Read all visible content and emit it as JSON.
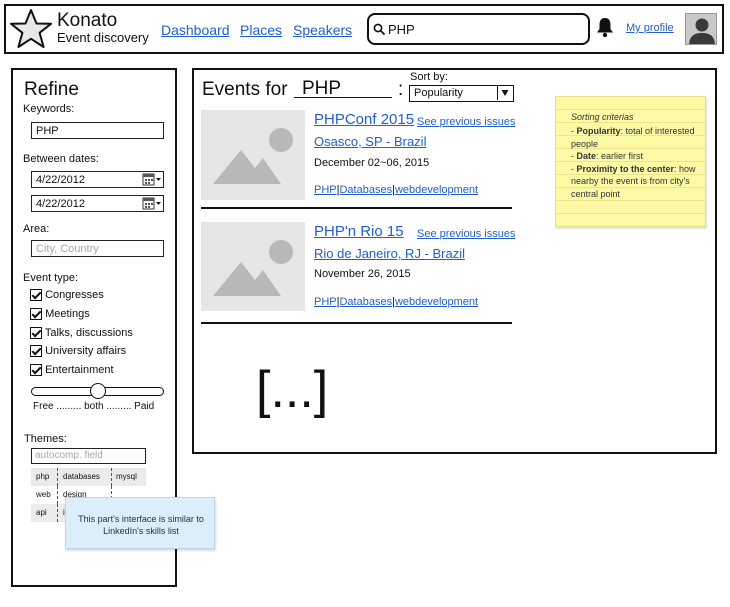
{
  "header": {
    "brand_name": "Konato",
    "brand_tagline": "Event discovery",
    "nav": [
      "Dashboard",
      "Places",
      "Speakers"
    ],
    "search_value": "PHP",
    "profile_link": "My profile"
  },
  "sidebar": {
    "title": "Refine",
    "keywords_label": "Keywords:",
    "keywords_value": "PHP",
    "dates_label": "Between dates:",
    "date_from": "4/22/2012",
    "date_to": "4/22/2012",
    "area_label": "Area:",
    "area_placeholder": "City, Country",
    "event_type_label": "Event type:",
    "event_types": [
      "Congresses",
      "Meetings",
      "Talks, discussions",
      "University affairs",
      "Entertainment"
    ],
    "price_scale": "Free ......... both ......... Paid",
    "price_value": 0.5,
    "themes_label": "Themes:",
    "themes_placeholder": "autocomp. field",
    "themes": [
      [
        "php",
        "databases",
        "mysql"
      ],
      [
        "web",
        "design",
        ""
      ],
      [
        "api",
        "i",
        ""
      ]
    ],
    "themes_note": "This part's interface is similar to LinkedIn's skills list"
  },
  "main": {
    "events_for_label": "Events for",
    "query": "PHP",
    "colon": ":",
    "sort_label": "Sort by:",
    "sort_value": "Popularity",
    "see_previous": "See previous issues",
    "events": [
      {
        "title": "PHPConf 2015",
        "location": "Osasco, SP - Brazil",
        "date": "December 02~06, 2015",
        "tags": [
          "PHP",
          "Databases",
          "webdevelopment"
        ]
      },
      {
        "title": "PHP'n Rio 15",
        "location": "Rio de Janeiro, RJ - Brazil",
        "date": "November 26, 2015",
        "tags": [
          "PHP",
          "Databases",
          "webdevelopment"
        ]
      }
    ],
    "more_placeholder": "[...]"
  },
  "sorting_note": {
    "heading": "Sorting criterias",
    "items": [
      {
        "bold": "Popularity",
        "text": ": total of interested people"
      },
      {
        "bold": "Date",
        "text": ": earlier first"
      },
      {
        "bold": "Proximity to the center",
        "text": ": how nearby the event is from city's central point"
      }
    ]
  },
  "colors": {
    "link": "#1f5fd0",
    "sticky_yellow": "#fdfaa6",
    "sticky_blue": "#dbeefa",
    "image_placeholder": "#e6e6e6"
  }
}
